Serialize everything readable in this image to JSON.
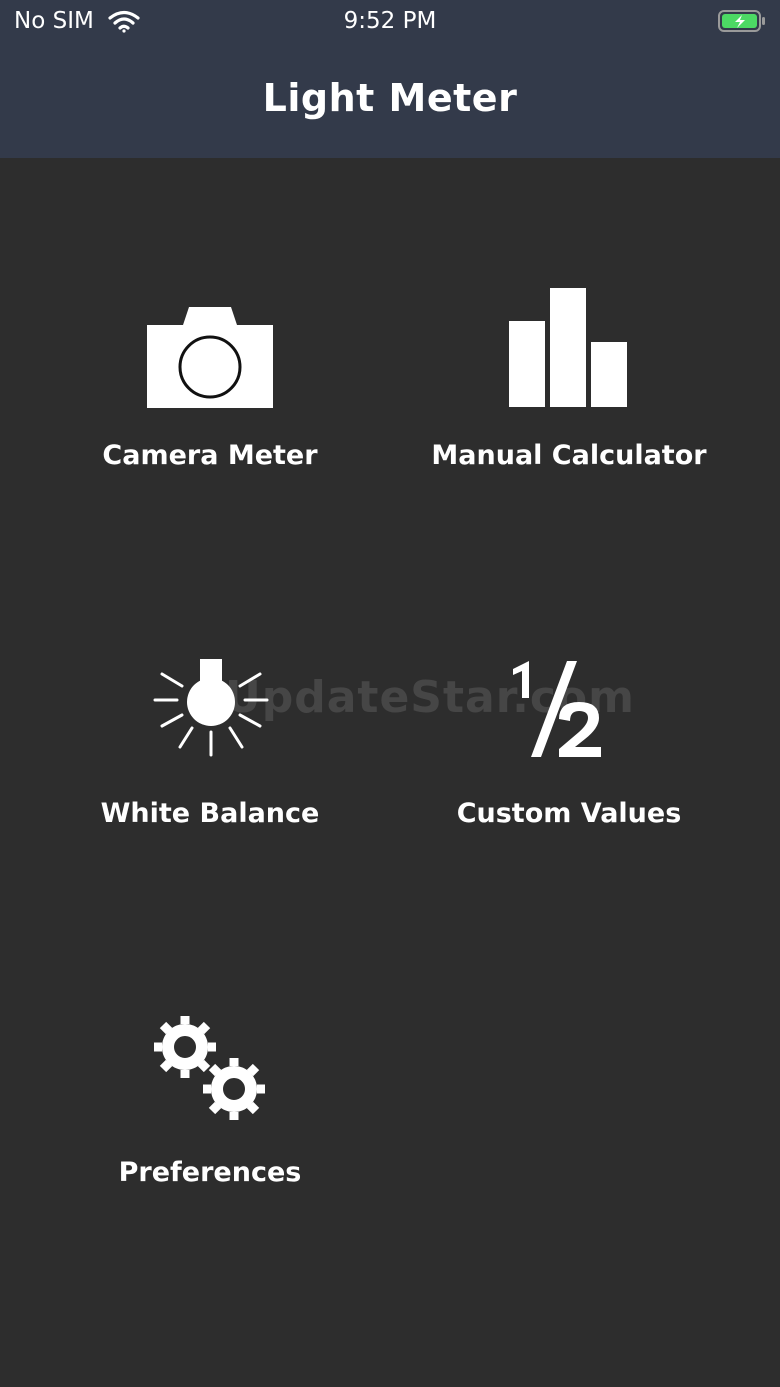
{
  "status_bar": {
    "carrier": "No SIM",
    "time": "9:52 PM",
    "battery_color": "#4cd964"
  },
  "header": {
    "title": "Light Meter",
    "background": "#333a4a"
  },
  "menu": {
    "items": [
      {
        "label": "Camera Meter",
        "icon": "camera-icon"
      },
      {
        "label": "Manual Calculator",
        "icon": "bar-chart-icon"
      },
      {
        "label": "White Balance",
        "icon": "light-bulb-icon"
      },
      {
        "label": "Custom Values",
        "icon": "one-half-icon"
      },
      {
        "label": "Preferences",
        "icon": "gears-icon"
      }
    ]
  },
  "watermark": "UpdateStar.com"
}
